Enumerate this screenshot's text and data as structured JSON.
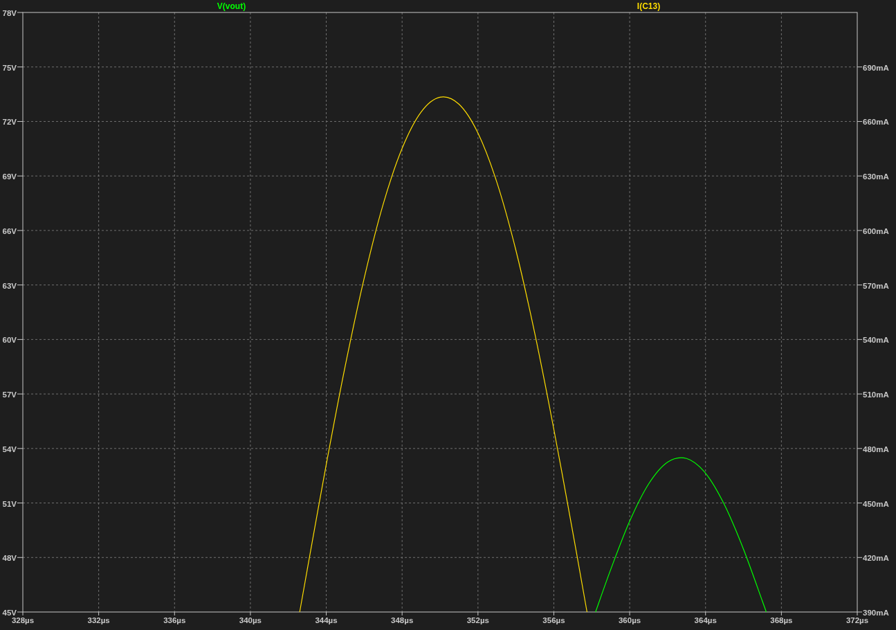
{
  "chart_data": {
    "type": "line",
    "x": [
      342.6,
      343,
      344,
      345,
      346,
      347,
      348,
      349,
      350,
      351,
      352,
      353,
      354,
      355,
      356,
      357,
      357.75,
      358.2,
      359,
      360,
      361,
      362,
      363,
      364,
      365,
      366,
      367,
      367.2
    ],
    "series": [
      {
        "name": "V(vout)",
        "color": "#00ff00",
        "axis": "y",
        "values": [
          null,
          null,
          null,
          null,
          null,
          null,
          null,
          null,
          null,
          null,
          null,
          null,
          null,
          null,
          null,
          null,
          null,
          45,
          47.34,
          50.0,
          52.05,
          53.25,
          53.45,
          52.64,
          50.9,
          48.46,
          45.59,
          45
        ]
      },
      {
        "name": "I(C13)",
        "color": "#ffdd00",
        "axis": "y2",
        "values": [
          390,
          413.5,
          471.2,
          525.4,
          573.7,
          614.4,
          645.2,
          665.2,
          673.4,
          669.5,
          653.6,
          626.4,
          589.1,
          543.1,
          490.6,
          433.9,
          390,
          null,
          null,
          null,
          null,
          null,
          null,
          null,
          null,
          null,
          null,
          null
        ]
      }
    ],
    "grid": true,
    "xlim": [
      328,
      372
    ],
    "ylim": [
      45,
      78
    ],
    "y2lim": [
      390,
      720
    ],
    "xticks": [
      {
        "value": 328,
        "label": "328µs"
      },
      {
        "value": 332,
        "label": "332µs"
      },
      {
        "value": 336,
        "label": "336µs"
      },
      {
        "value": 340,
        "label": "340µs"
      },
      {
        "value": 344,
        "label": "344µs"
      },
      {
        "value": 348,
        "label": "348µs"
      },
      {
        "value": 352,
        "label": "352µs"
      },
      {
        "value": 356,
        "label": "356µs"
      },
      {
        "value": 360,
        "label": "360µs"
      },
      {
        "value": 364,
        "label": "364µs"
      },
      {
        "value": 368,
        "label": "368µs"
      },
      {
        "value": 372,
        "label": "372µs"
      }
    ],
    "yticks": [
      {
        "value": 45,
        "label": "45V"
      },
      {
        "value": 48,
        "label": "48V"
      },
      {
        "value": 51,
        "label": "51V"
      },
      {
        "value": 54,
        "label": "54V"
      },
      {
        "value": 57,
        "label": "57V"
      },
      {
        "value": 60,
        "label": "60V"
      },
      {
        "value": 63,
        "label": "63V"
      },
      {
        "value": 66,
        "label": "66V"
      },
      {
        "value": 69,
        "label": "69V"
      },
      {
        "value": 72,
        "label": "72V"
      },
      {
        "value": 75,
        "label": "75V"
      },
      {
        "value": 78,
        "label": "78V"
      }
    ],
    "y2ticks": [
      {
        "value": 390,
        "label": "390mA"
      },
      {
        "value": 420,
        "label": "420mA"
      },
      {
        "value": 450,
        "label": "450mA"
      },
      {
        "value": 480,
        "label": "480mA"
      },
      {
        "value": 510,
        "label": "510mA"
      },
      {
        "value": 540,
        "label": "540mA"
      },
      {
        "value": 570,
        "label": "570mA"
      },
      {
        "value": 600,
        "label": "600mA"
      },
      {
        "value": 630,
        "label": "630mA"
      },
      {
        "value": 660,
        "label": "660mA"
      },
      {
        "value": 690,
        "label": "690mA"
      }
    ]
  }
}
